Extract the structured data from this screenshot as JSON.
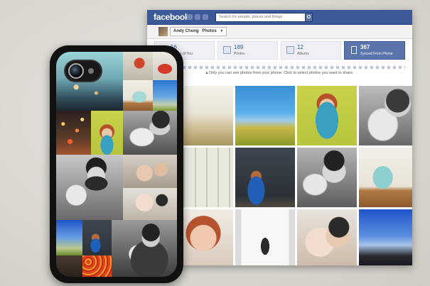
{
  "header": {
    "logo": "facebook",
    "search_placeholder": "Search for people, places and things"
  },
  "profile": {
    "name": "Andy Chung",
    "section": "Photos"
  },
  "tabs": [
    {
      "count": "56",
      "label": "Photos of You"
    },
    {
      "count": "189",
      "label": "Photos"
    },
    {
      "count": "12",
      "label": "Albums"
    },
    {
      "count": "367",
      "label": "Synced From Phone"
    }
  ],
  "notice": "Only you can see photos from your phone. Click to select photos you want to share.",
  "colors": {
    "brand": "#3b5998",
    "active_tab": "#5a74ac"
  }
}
